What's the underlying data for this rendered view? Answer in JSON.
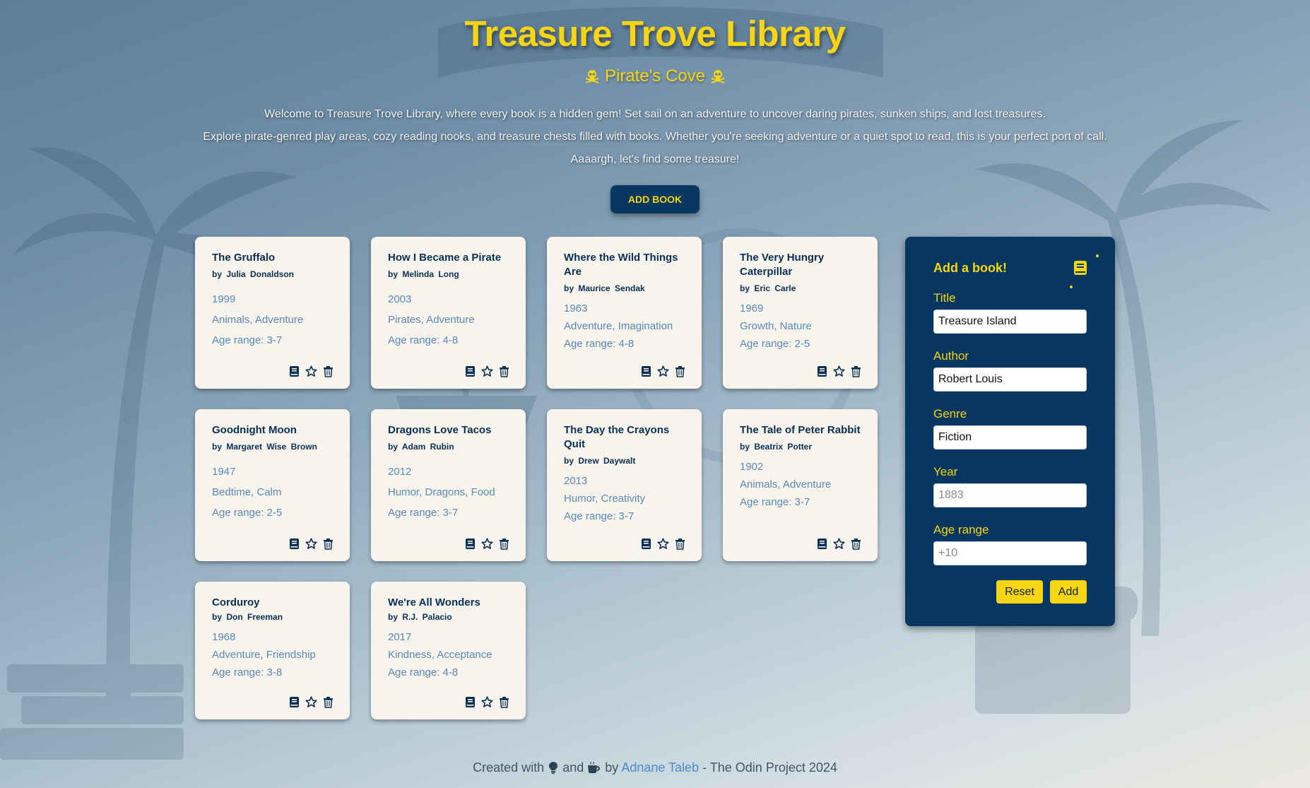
{
  "header": {
    "title": "Treasure Trove Library",
    "subtitle": "Pirate's Cove",
    "intro_lines": [
      "Welcome to Treasure Trove Library, where every book is a hidden gem! Set sail on an adventure to uncover daring pirates, sunken ships, and lost treasures.",
      "Explore pirate-genred play areas, cozy reading nooks, and treasure chests filled with books. Whether you're seeking adventure or a quiet spot to read, this is your perfect port of call.",
      "Aaaargh, let's find some treasure!"
    ],
    "add_book_label": "ADD BOOK"
  },
  "books": [
    {
      "title": "The Gruffalo",
      "author": "by Julia Donaldson",
      "year": "1999",
      "genre": "Animals, Adventure",
      "age": "Age range: 3-7"
    },
    {
      "title": "How I Became a Pirate",
      "author": "by Melinda Long",
      "year": "2003",
      "genre": "Pirates, Adventure",
      "age": "Age range: 4-8"
    },
    {
      "title": "Where the Wild Things Are",
      "author": "by Maurice Sendak",
      "year": "1963",
      "genre": "Adventure, Imagination",
      "age": "Age range: 4-8"
    },
    {
      "title": "The Very Hungry Caterpillar",
      "author": "by Eric Carle",
      "year": "1969",
      "genre": "Growth, Nature",
      "age": "Age range: 2-5"
    },
    {
      "title": "Goodnight Moon",
      "author": "by Margaret Wise Brown",
      "year": "1947",
      "genre": "Bedtime, Calm",
      "age": "Age range: 2-5"
    },
    {
      "title": "Dragons Love Tacos",
      "author": "by Adam Rubin",
      "year": "2012",
      "genre": "Humor, Dragons, Food",
      "age": "Age range: 3-7"
    },
    {
      "title": "The Day the Crayons Quit",
      "author": "by Drew Daywalt",
      "year": "2013",
      "genre": "Humor, Creativity",
      "age": "Age range: 3-7"
    },
    {
      "title": "The Tale of Peter Rabbit",
      "author": "by Beatrix Potter",
      "year": "1902",
      "genre": "Animals, Adventure",
      "age": "Age range: 3-7"
    },
    {
      "title": "Corduroy",
      "author": "by Don Freeman",
      "year": "1968",
      "genre": "Adventure, Friendship",
      "age": "Age range: 3-8"
    },
    {
      "title": "We're All Wonders",
      "author": "by R.J. Palacio",
      "year": "2017",
      "genre": "Kindness, Acceptance",
      "age": "Age range: 4-8"
    }
  ],
  "card_icons": [
    "book-icon",
    "star-icon",
    "trash-icon"
  ],
  "form": {
    "title": "Add a book!",
    "title_label": "Title",
    "title_value": "Treasure Island",
    "author_label": "Author",
    "author_value": "Robert Louis",
    "genre_label": "Genre",
    "genre_value": "Fiction",
    "year_label": "Year",
    "year_placeholder": "1883",
    "age_label": "Age range",
    "age_placeholder": "+10",
    "reset_label": "Reset",
    "add_label": "Add"
  },
  "footer": {
    "created_with": "Created with",
    "and": "and",
    "by": "by",
    "author_link": "Adnane Taleb",
    "suffix": "- The Odin Project 2024"
  },
  "colors": {
    "accent": "#f6d514",
    "navy": "#073661",
    "card_bg": "#f6f4ec",
    "meta_text": "#5c88b3",
    "link": "#4a8cc9"
  }
}
